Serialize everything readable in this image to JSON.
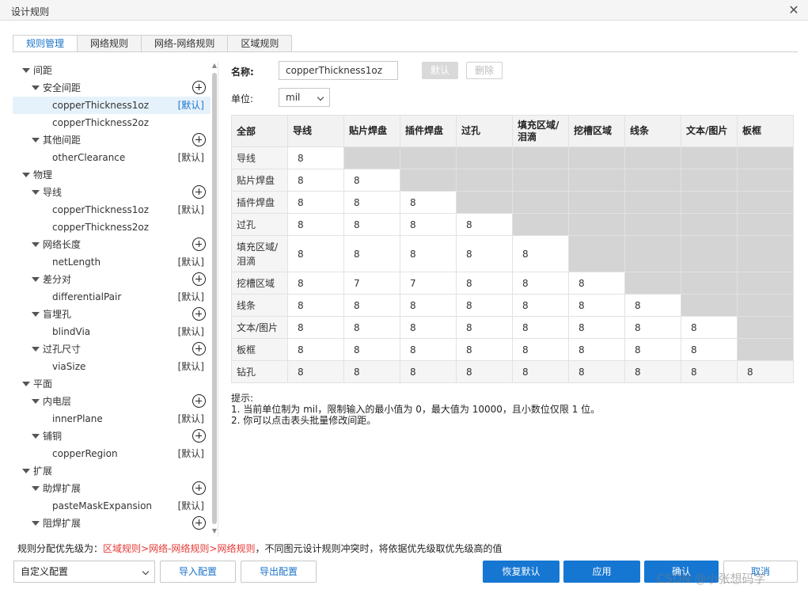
{
  "window": {
    "title": "设计规则",
    "close_label": "✕"
  },
  "tabs": [
    "规则管理",
    "网络规则",
    "网络-网络规则",
    "区域规则"
  ],
  "tree": [
    {
      "label": "间距",
      "level": 0,
      "caret": true
    },
    {
      "label": "安全间距",
      "level": 1,
      "caret": true,
      "plus": true
    },
    {
      "label": "copperThickness1oz",
      "level": 2,
      "tag": "[默认]",
      "selected": true
    },
    {
      "label": "copperThickness2oz",
      "level": 2
    },
    {
      "label": "其他间距",
      "level": 1,
      "caret": true,
      "plus": true
    },
    {
      "label": "otherClearance",
      "level": 2,
      "tag": "[默认]"
    },
    {
      "label": "物理",
      "level": 0,
      "caret": true
    },
    {
      "label": "导线",
      "level": 1,
      "caret": true,
      "plus": true
    },
    {
      "label": "copperThickness1oz",
      "level": 2,
      "tag": "[默认]"
    },
    {
      "label": "copperThickness2oz",
      "level": 2
    },
    {
      "label": "网络长度",
      "level": 1,
      "caret": true,
      "plus": true
    },
    {
      "label": "netLength",
      "level": 2,
      "tag": "[默认]"
    },
    {
      "label": "差分对",
      "level": 1,
      "caret": true,
      "plus": true
    },
    {
      "label": "differentialPair",
      "level": 2,
      "tag": "[默认]"
    },
    {
      "label": "盲埋孔",
      "level": 1,
      "caret": true,
      "plus": true
    },
    {
      "label": "blindVia",
      "level": 2,
      "tag": "[默认]"
    },
    {
      "label": "过孔尺寸",
      "level": 1,
      "caret": true,
      "plus": true
    },
    {
      "label": "viaSize",
      "level": 2,
      "tag": "[默认]"
    },
    {
      "label": "平面",
      "level": 0,
      "caret": true
    },
    {
      "label": "内电层",
      "level": 1,
      "caret": true,
      "plus": true
    },
    {
      "label": "innerPlane",
      "level": 2,
      "tag": "[默认]"
    },
    {
      "label": "铺铜",
      "level": 1,
      "caret": true,
      "plus": true
    },
    {
      "label": "copperRegion",
      "level": 2,
      "tag": "[默认]"
    },
    {
      "label": "扩展",
      "level": 0,
      "caret": true
    },
    {
      "label": "助焊扩展",
      "level": 1,
      "caret": true,
      "plus": true
    },
    {
      "label": "pasteMaskExpansion",
      "level": 2,
      "tag": "[默认]"
    },
    {
      "label": "阻焊扩展",
      "level": 1,
      "caret": true,
      "plus": true
    }
  ],
  "form": {
    "name_label": "名称:",
    "name_value": "copperThickness1oz",
    "default_btn": "默认",
    "delete_btn": "删除",
    "unit_label": "单位:",
    "unit_value": "mil"
  },
  "matrix": {
    "corner": "全部",
    "columns": [
      "导线",
      "贴片焊盘",
      "插件焊盘",
      "过孔",
      "填充区域/\n泪滴",
      "挖槽区域",
      "线条",
      "文本/图片",
      "板框"
    ],
    "rows": [
      {
        "label": "导线",
        "values": [
          "8"
        ]
      },
      {
        "label": "贴片焊盘",
        "values": [
          "8",
          "8"
        ]
      },
      {
        "label": "插件焊盘",
        "values": [
          "8",
          "8",
          "8"
        ]
      },
      {
        "label": "过孔",
        "values": [
          "8",
          "8",
          "8",
          "8"
        ]
      },
      {
        "label": "填充区域/\n泪滴",
        "values": [
          "8",
          "8",
          "8",
          "8",
          "8"
        ]
      },
      {
        "label": "挖槽区域",
        "values": [
          "8",
          "7",
          "7",
          "8",
          "8",
          "8"
        ]
      },
      {
        "label": "线条",
        "values": [
          "8",
          "8",
          "8",
          "8",
          "8",
          "8",
          "8"
        ]
      },
      {
        "label": "文本/图片",
        "values": [
          "8",
          "8",
          "8",
          "8",
          "8",
          "8",
          "8",
          "8"
        ]
      },
      {
        "label": "板框",
        "values": [
          "8",
          "8",
          "8",
          "8",
          "8",
          "8",
          "8",
          "8"
        ]
      },
      {
        "label": "钻孔",
        "values": [
          "8",
          "8",
          "8",
          "8",
          "8",
          "8",
          "8",
          "8",
          "8"
        ]
      }
    ]
  },
  "tips": {
    "heading": "提示:",
    "line1": "1. 当前单位制为 mil，限制输入的最小值为 0，最大值为 10000，且小数位仅限 1 位。",
    "line2": "2. 你可以点击表头批量修改间距。"
  },
  "priority": {
    "prefix": "规则分配优先级为：",
    "order": "区域规则>网络-网络规则>网络规则",
    "suffix": "，不同图元设计规则冲突时，将依据优先级取优先级高的值"
  },
  "footer": {
    "config_select": "自定义配置",
    "import_btn": "导入配置",
    "export_btn": "导出配置",
    "restore_btn": "恢复默认",
    "apply_btn": "应用",
    "ok_btn": "确认",
    "cancel_btn": "取消"
  },
  "watermark": "CSDN @小张想码字",
  "colors": {
    "accent": "#1677d2",
    "link_red": "#e53935",
    "disabled_cell": "#d4d4d4"
  }
}
